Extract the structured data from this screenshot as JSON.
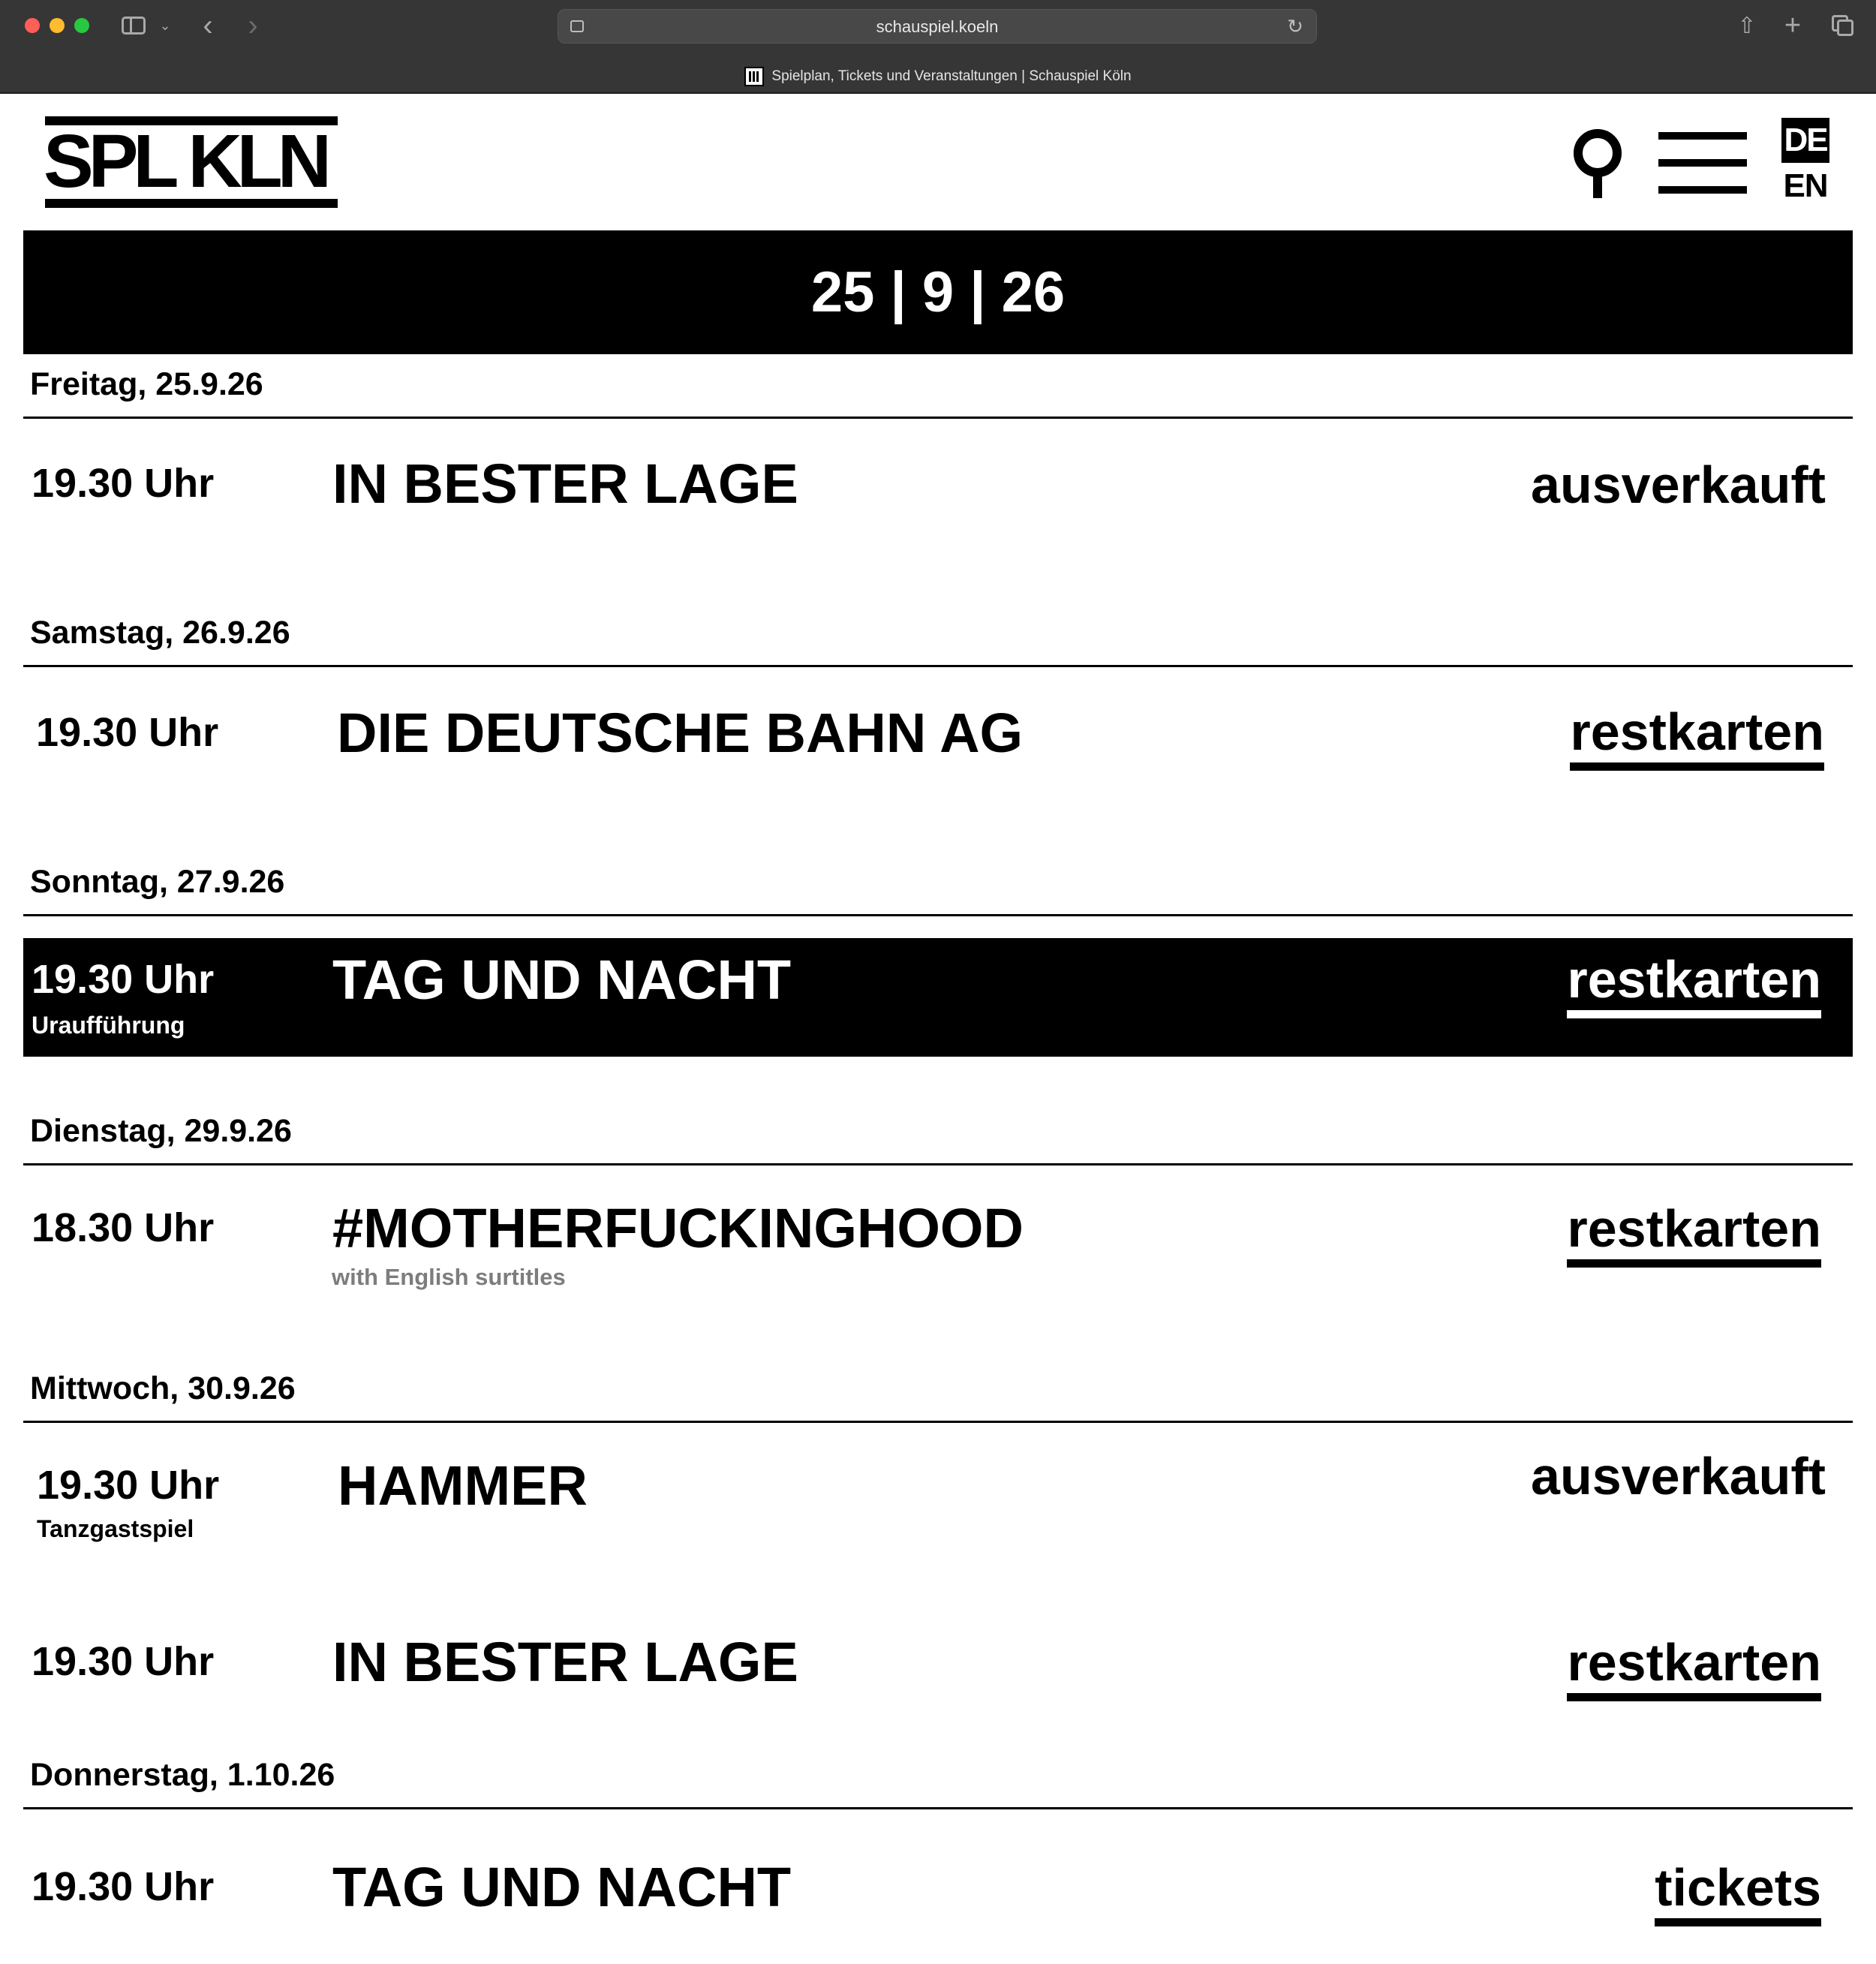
{
  "browser": {
    "url": "schauspiel.koeln",
    "tab_title": "Spielplan, Tickets und Veranstaltungen | Schauspiel Köln",
    "icons": [
      "sidebar-icon",
      "chevron-down-icon",
      "back-icon",
      "forward-icon",
      "site-settings-icon",
      "reload-icon",
      "share-icon",
      "plus-icon",
      "tabs-overview-icon"
    ]
  },
  "header": {
    "logo_text": "SPL KLN",
    "lang_active": "DE",
    "lang_other": "EN",
    "icons": [
      "search-icon",
      "menu-icon"
    ]
  },
  "banner": {
    "date_range": "25 | 9 | 26"
  },
  "days": [
    {
      "heading": "Freitag, 25.9.26",
      "events": [
        {
          "time": "19.30 Uhr",
          "title": "IN BESTER LAGE",
          "status": "ausverkauft"
        }
      ]
    },
    {
      "heading": "Samstag, 26.9.26",
      "events": [
        {
          "time": "19.30 Uhr",
          "title": "DIE DEUTSCHE BAHN AG",
          "status": "restkarten"
        }
      ]
    },
    {
      "heading": "Sonntag, 27.9.26",
      "events": [
        {
          "time": "19.30 Uhr",
          "subtitle": "Uraufführung",
          "title": "TAG UND NACHT",
          "status": "restkarten",
          "highlighted": true
        }
      ]
    },
    {
      "heading": "Dienstag, 29.9.26",
      "events": [
        {
          "time": "18.30 Uhr",
          "title": "#MOTHERFUCKINGHOOD",
          "note": "with English surtitles",
          "status": "restkarten"
        }
      ]
    },
    {
      "heading": "Mittwoch, 30.9.26",
      "events": [
        {
          "time": "19.30 Uhr",
          "subtitle": "Tanzgastspiel",
          "title": "HAMMER",
          "status": "ausverkauft"
        },
        {
          "time": "19.30 Uhr",
          "title": "IN BESTER LAGE",
          "status": "restkarten"
        }
      ]
    },
    {
      "heading": "Donnerstag, 1.10.26",
      "events": [
        {
          "time": "19.30 Uhr",
          "title": "TAG UND NACHT",
          "status": "tickets"
        }
      ]
    }
  ],
  "colors": {
    "chrome_bg": "#363636",
    "text": "#000000",
    "background": "#ffffff",
    "note_gray": "#7d7d7d"
  }
}
